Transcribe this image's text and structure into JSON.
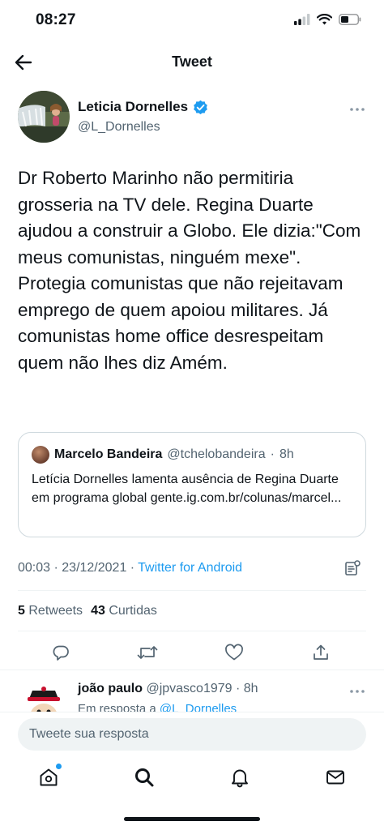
{
  "status_bar": {
    "time": "08:27"
  },
  "header": {
    "title": "Tweet"
  },
  "author": {
    "name": "Leticia Dornelles",
    "handle": "@L_Dornelles",
    "verified": true
  },
  "tweet": {
    "text": "Dr Roberto Marinho não permitiria grosseria na TV dele. Regina Duarte ajudou a construir a Globo. Ele dizia:\"Com meus comunistas, ninguém mexe\". Protegia comunistas que não rejeitavam emprego de quem apoiou militares. Já comunistas home office desrespeitam quem não lhes diz Amém.",
    "time": "00:03",
    "date": "23/12/2021",
    "source": "Twitter for Android",
    "retweets_count": "5",
    "retweets_label": "Retweets",
    "likes_count": "43",
    "likes_label": "Curtidas"
  },
  "quote": {
    "name": "Marcelo Bandeira",
    "handle": "@tchelobandeira",
    "age": "8h",
    "text": "Letícia Dornelles lamenta ausência de Regina Duarte em programa global gente.ig.com.br/colunas/marcel..."
  },
  "reply": {
    "name": "joão paulo",
    "handle": "@jpvasco1979",
    "age": "8h",
    "prefix": "Em resposta a",
    "mention": "@L_Dornelles"
  },
  "composer": {
    "placeholder": "Tweete sua resposta"
  },
  "colors": {
    "accent": "#1d9bf0",
    "text": "#0f1419",
    "secondary": "#536471",
    "divider": "#eff3f4"
  },
  "icons": {
    "back": "arrow-left-icon",
    "verified": "verified-badge-icon",
    "more": "more-horizontal-icon",
    "analytics": "analytics-icon",
    "reply": "reply-icon",
    "retweet": "retweet-icon",
    "like": "heart-icon",
    "share": "share-icon",
    "home": "home-icon",
    "search": "search-icon",
    "notifications": "bell-icon",
    "messages": "mail-icon"
  }
}
